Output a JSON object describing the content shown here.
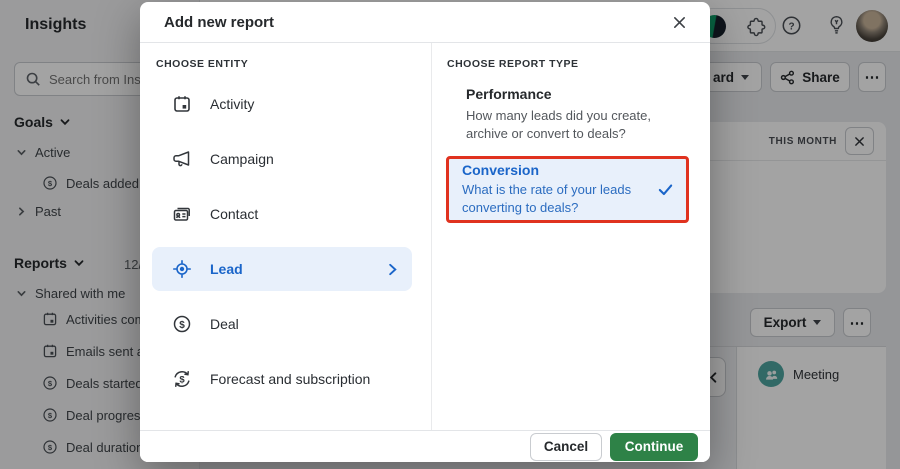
{
  "colors": {
    "accent_blue": "#1a65c9",
    "selected_bg": "#e8f0fb",
    "highlight_red": "#e0321f",
    "green": "#2e8247",
    "teal": "#4ea5a0"
  },
  "topbar": {
    "page_title": "Insights",
    "buttons": {
      "dashboard_fragment": "ard",
      "share": "Share",
      "more": "⋯"
    }
  },
  "sidebar": {
    "search_placeholder": "Search from Ins",
    "goals": {
      "label": "Goals",
      "active_label": "Active",
      "active_item": "Deals added b",
      "past_label": "Past"
    },
    "reports": {
      "label": "Reports",
      "count_fragment": "12/",
      "group_label": "Shared with me",
      "items": [
        {
          "label": "Activities com",
          "icon": "calendar-icon"
        },
        {
          "label": "Emails sent a",
          "icon": "calendar-icon"
        },
        {
          "label": "Deals started",
          "icon": "dollar-circle-icon"
        },
        {
          "label": "Deal progress",
          "icon": "dollar-circle-icon"
        },
        {
          "label": "Deal duration",
          "icon": "dollar-circle-icon"
        }
      ]
    }
  },
  "content": {
    "period_label": "THIS MONTH",
    "export_label": "Export",
    "more_label": "⋯",
    "legend": {
      "meeting": "Meeting"
    }
  },
  "modal": {
    "title": "Add new report",
    "entity": {
      "header": "CHOOSE ENTITY",
      "items": [
        {
          "label": "Activity",
          "icon": "calendar-icon",
          "selected": false
        },
        {
          "label": "Campaign",
          "icon": "megaphone-icon",
          "selected": false
        },
        {
          "label": "Contact",
          "icon": "contact-card-icon",
          "selected": false
        },
        {
          "label": "Lead",
          "icon": "lead-target-icon",
          "selected": true
        },
        {
          "label": "Deal",
          "icon": "dollar-circle-icon",
          "selected": false
        },
        {
          "label": "Forecast and subscription",
          "icon": "forecast-cycle-icon",
          "selected": false
        }
      ]
    },
    "report_type": {
      "header": "CHOOSE REPORT TYPE",
      "options": [
        {
          "title": "Performance",
          "description": "How many leads did you create, archive or convert to deals?",
          "selected": false
        },
        {
          "title": "Conversion",
          "description": "What is the rate of your leads converting to deals?",
          "selected": true
        }
      ]
    },
    "footer": {
      "cancel": "Cancel",
      "continue": "Continue"
    }
  }
}
